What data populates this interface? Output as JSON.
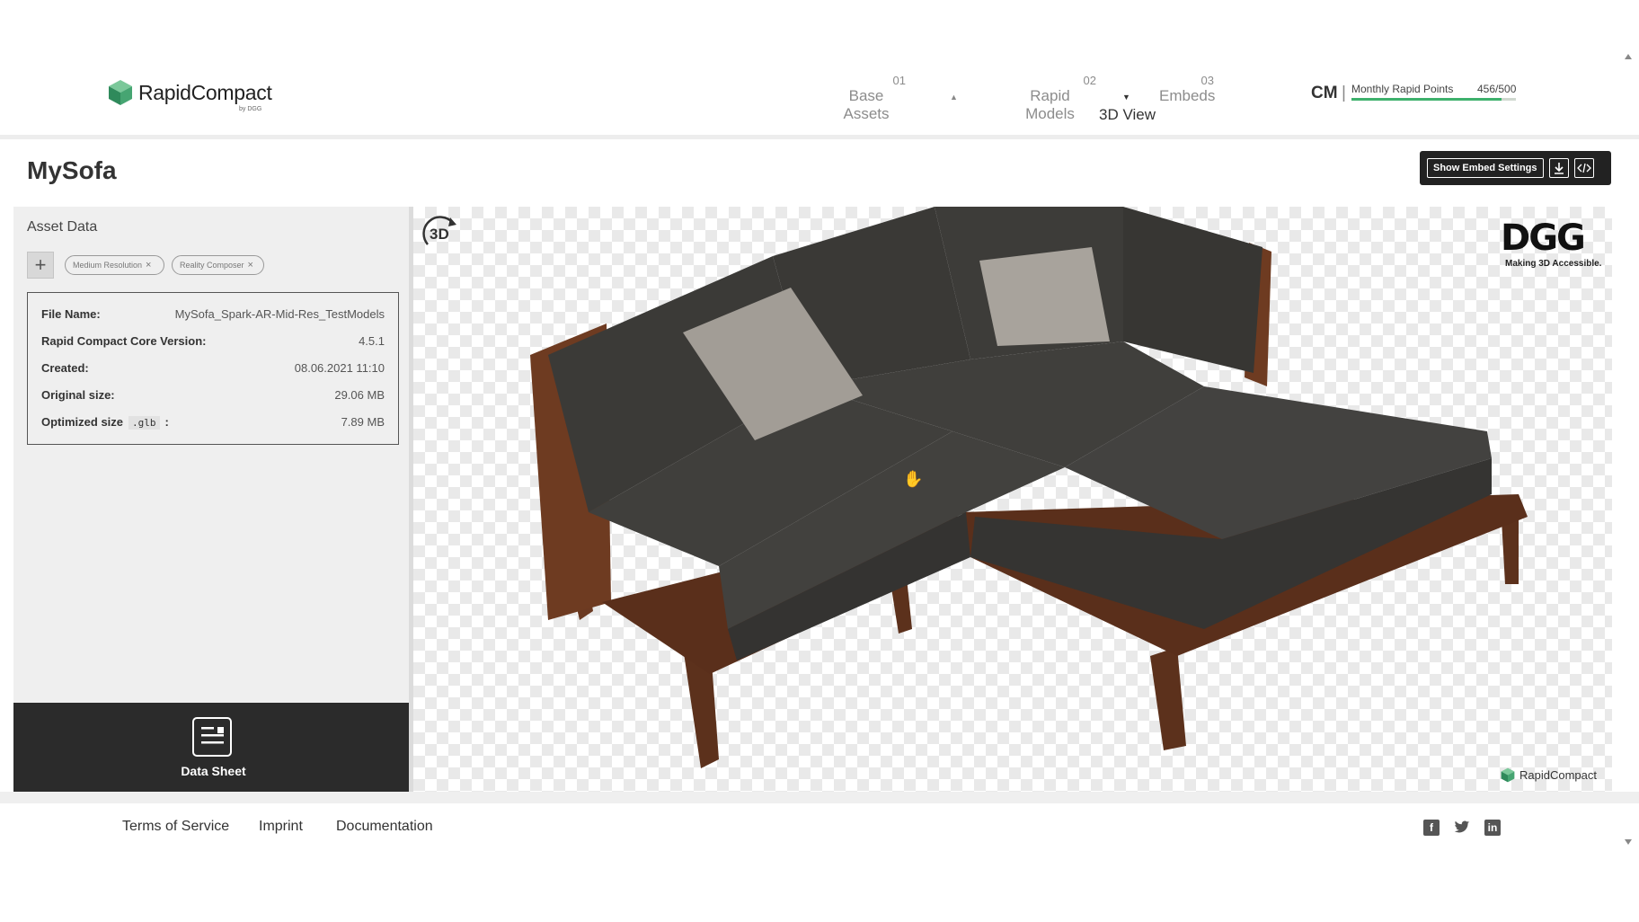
{
  "header": {
    "brand": "RapidCompact",
    "brand_sub": "by DGG",
    "steps": [
      {
        "num": "01",
        "label": "Base Assets"
      },
      {
        "num": "02",
        "label": "Rapid Models"
      },
      {
        "num": "03",
        "label": "Embeds"
      }
    ],
    "current_view": "3D View",
    "user_initials": "CM",
    "points_label": "Monthly Rapid Points",
    "points_value": "456/500",
    "points_fraction": 0.912
  },
  "page": {
    "title": "MySofa",
    "embed_settings_label": "Show Embed Settings"
  },
  "sidebar": {
    "title": "Asset Data",
    "tags": [
      "Medium Resolution",
      "Reality Composer"
    ],
    "fields": [
      {
        "key": "File Name:",
        "value": "MySofa_Spark-AR-Mid-Res_TestModels"
      },
      {
        "key": "Rapid Compact Core Version:",
        "value": "4.5.1"
      },
      {
        "key": "Created:",
        "value": "08.06.2021 11:10"
      },
      {
        "key": "Original size:",
        "value": "29.06 MB"
      }
    ],
    "optimized": {
      "key": "Optimized size",
      "format": ".glb",
      "colon": ":",
      "value": "7.89 MB"
    },
    "sheet_label": "Data Sheet"
  },
  "viewer": {
    "badge": "3D",
    "dgg_logo": "DGG",
    "dgg_tagline": "Making 3D Accessible.",
    "watermark": "RapidCompact"
  },
  "footer": {
    "links": [
      "Terms of Service",
      "Imprint",
      "Documentation"
    ],
    "social": [
      "facebook-icon",
      "twitter-icon",
      "linkedin-icon"
    ]
  },
  "colors": {
    "accent_green": "#3db06c",
    "dark": "#2b2b2b",
    "sofa_fabric": "#3e3d3a",
    "sofa_wood": "#6b3a22"
  }
}
